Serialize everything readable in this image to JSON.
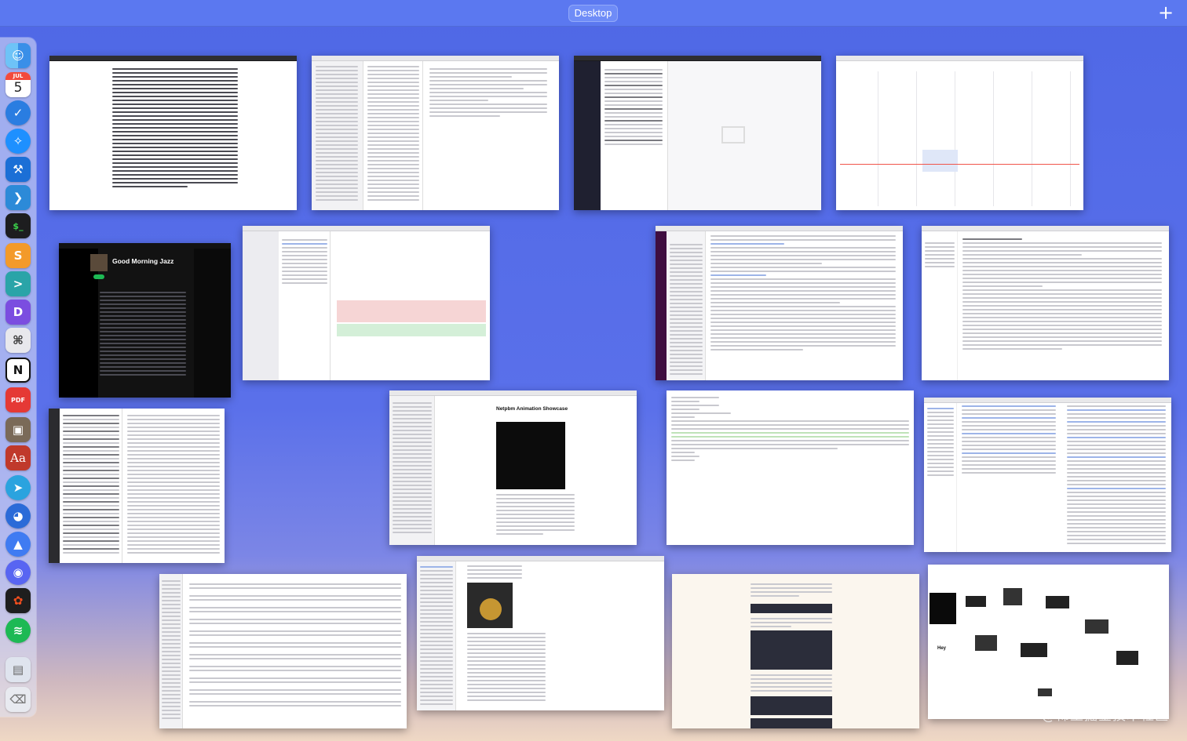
{
  "top_bar": {
    "space_label": "Desktop",
    "add_label": "+"
  },
  "dock": {
    "calendar_month": "JUL",
    "calendar_day": "5",
    "pdf_badge": "PDF",
    "dictionary_label": "Aa",
    "notion_label": "N"
  },
  "windows": {
    "music_title": "Good Morning Jazz",
    "netpbm_title": "Netpbm Animation Showcase",
    "chat_name": "Hey"
  },
  "watermark": "@稀土掘金技术社区"
}
